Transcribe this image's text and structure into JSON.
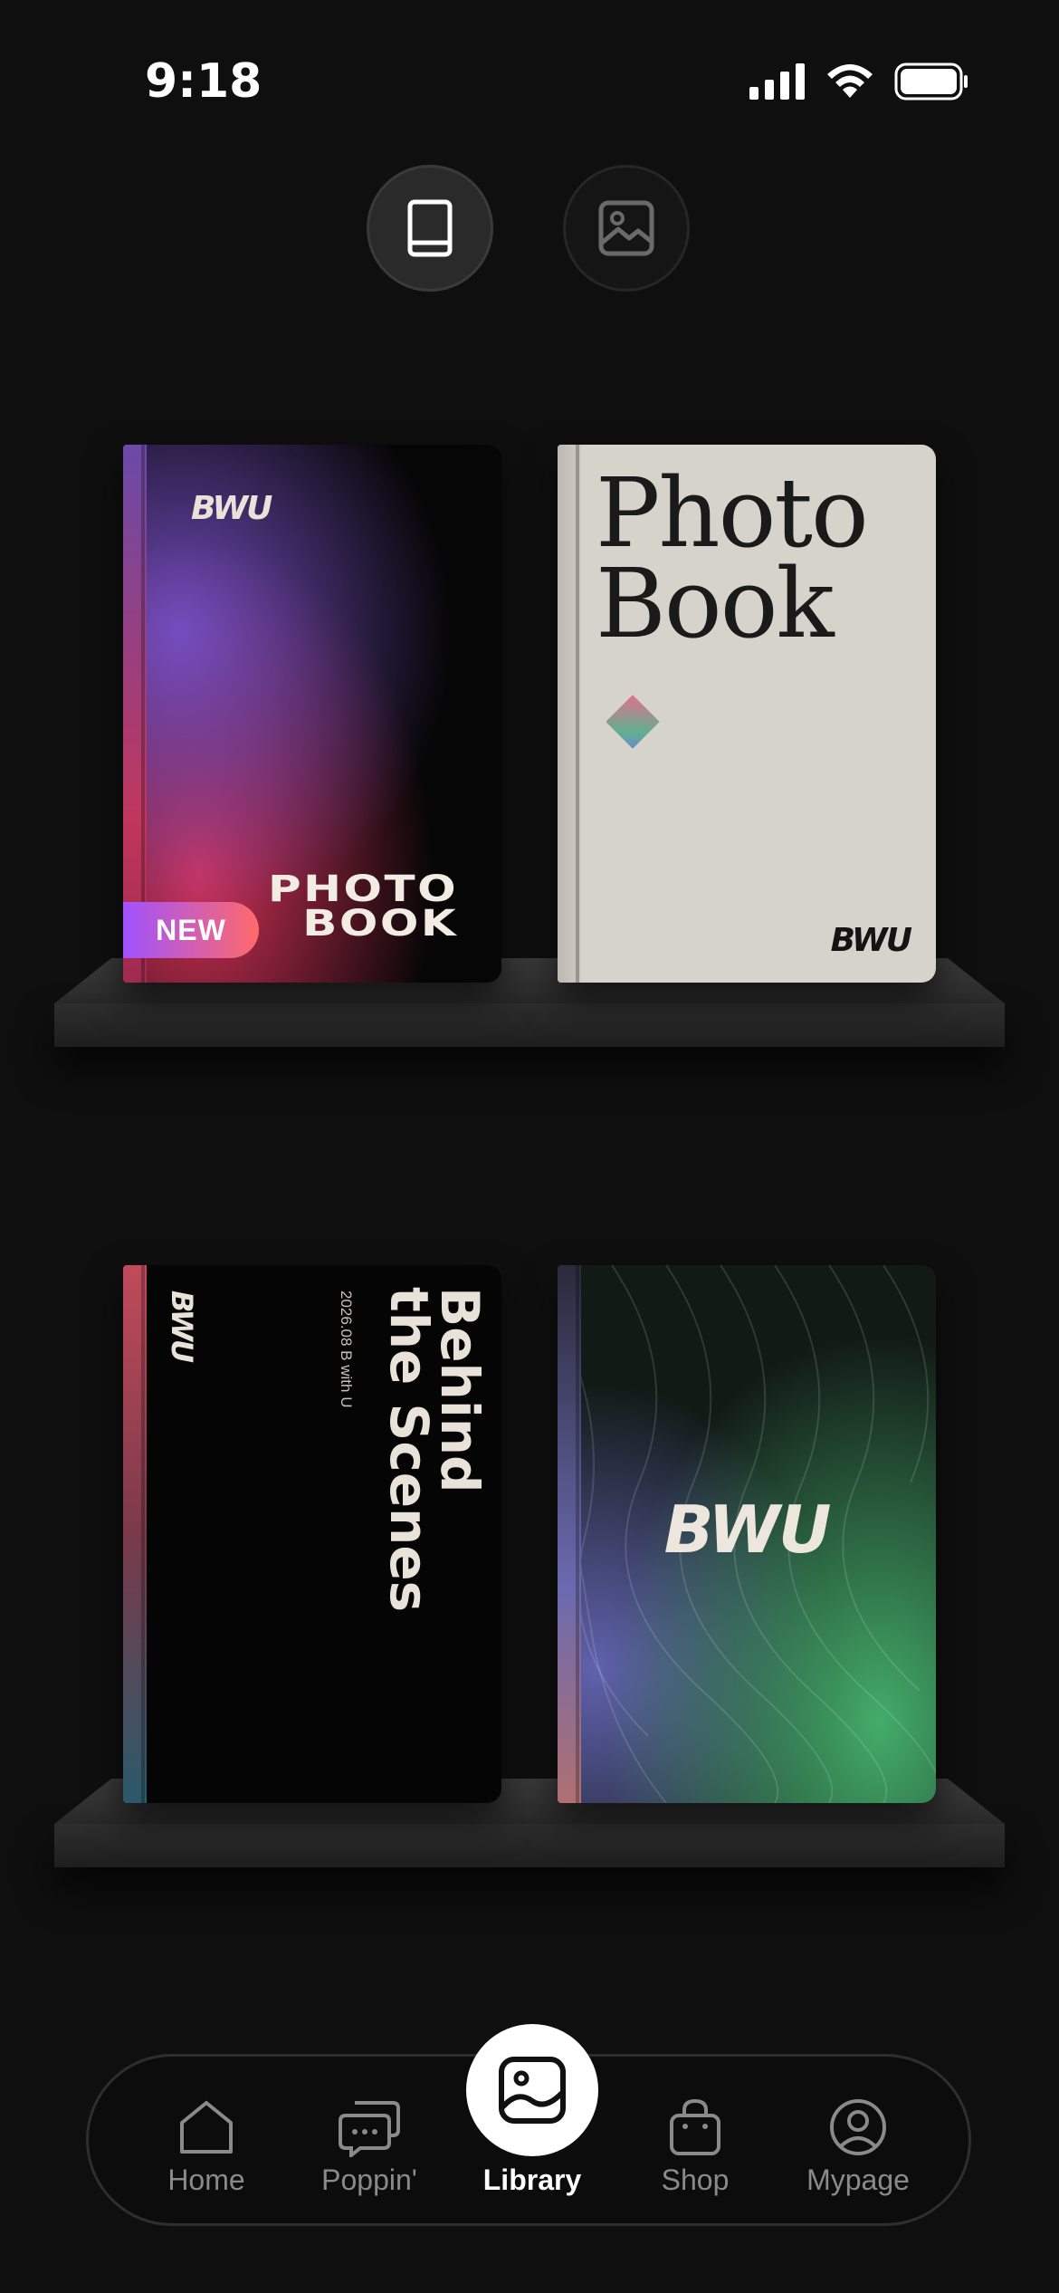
{
  "status_bar": {
    "time": "9:18"
  },
  "view_toggle": {
    "book_view_active": true
  },
  "books": [
    {
      "logo": "BWU",
      "title_line1": "PHOTO",
      "title_line2": "BOOK",
      "badge": "NEW"
    },
    {
      "title_line1": "Photo",
      "title_line2": "Book",
      "logo": "BWU"
    },
    {
      "logo": "BWU",
      "title_line1": "Behind",
      "title_line2": "the Scenes",
      "date": "2026.08 B with U"
    },
    {
      "logo": "BWU"
    }
  ],
  "tabs": [
    {
      "label": "Home",
      "icon": "home-icon"
    },
    {
      "label": "Poppin'",
      "icon": "chat-bubbles-icon"
    },
    {
      "label": "Library",
      "icon": "photo-album-icon"
    },
    {
      "label": "Shop",
      "icon": "shopping-bag-icon"
    },
    {
      "label": "Mypage",
      "icon": "user-circle-icon"
    }
  ],
  "colors": {
    "background": "#0f0f0f",
    "active_tab": "#ffffff",
    "inactive_tab": "#8a8a8a",
    "badge_start": "#a052ff",
    "badge_end": "#ff6a6a"
  }
}
